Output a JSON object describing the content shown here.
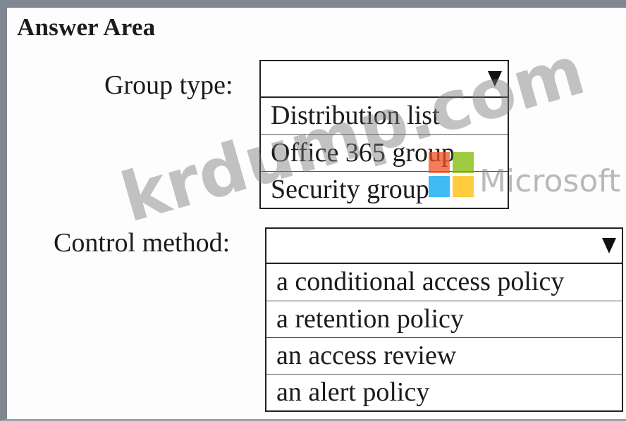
{
  "answer_area": {
    "title": "Answer Area"
  },
  "group_type": {
    "label": "Group type:",
    "selected": "",
    "options": [
      "Distribution list",
      "Office 365 group",
      "Security group"
    ]
  },
  "control_method": {
    "label": "Control method:",
    "selected": "",
    "options": [
      "a conditional access policy",
      "a retention policy",
      "an access review",
      "an alert policy"
    ]
  },
  "watermark": {
    "site": "krdump.com",
    "brand": "Microsoft"
  },
  "icons": {
    "dropdown": "chevron-down-icon",
    "logo": "microsoft-logo-icon"
  }
}
